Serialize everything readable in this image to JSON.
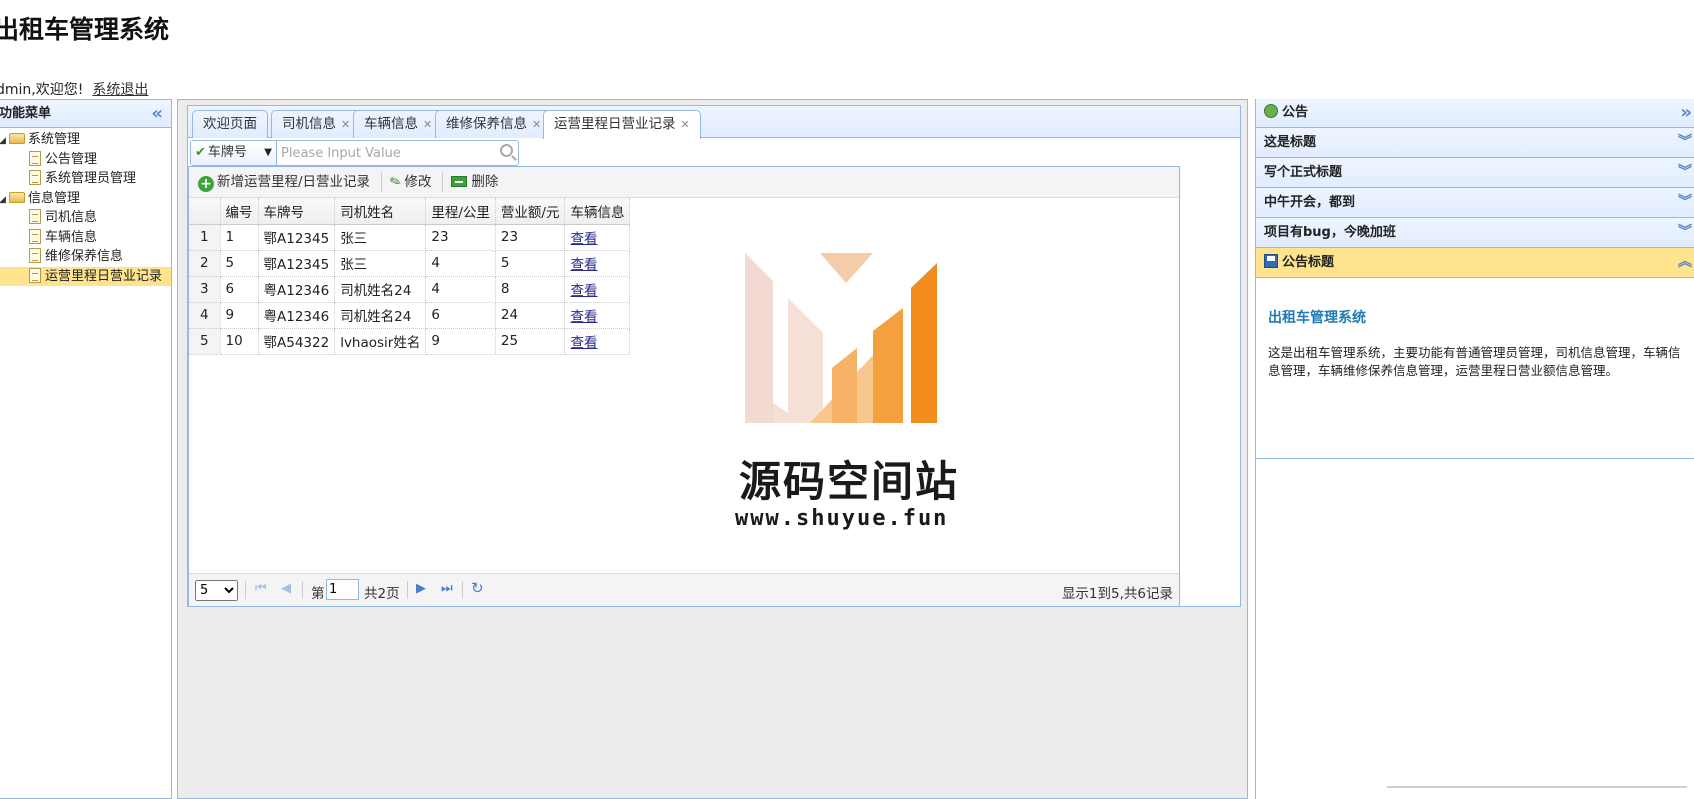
{
  "app": {
    "title": "出租车管理系统"
  },
  "user": {
    "welcome": "dmin,欢迎您!",
    "logout": "系统退出"
  },
  "menu": {
    "title": "功能菜单",
    "collapse_icon": "«",
    "groups": [
      {
        "label": "系统管理",
        "items": [
          "公告管理",
          "系统管理员管理"
        ]
      },
      {
        "label": "信息管理",
        "items": [
          "司机信息",
          "车辆信息",
          "维修保养信息",
          "运营里程日营业记录"
        ]
      }
    ]
  },
  "tabs": [
    {
      "label": "欢迎页面",
      "closable": false
    },
    {
      "label": "司机信息",
      "closable": true
    },
    {
      "label": "车辆信息",
      "closable": true
    },
    {
      "label": "维修保养信息",
      "closable": true
    },
    {
      "label": "运营里程日营业记录",
      "closable": true,
      "active": true
    }
  ],
  "search": {
    "field_label": "车牌号",
    "placeholder": "Please Input Value"
  },
  "toolbar": {
    "add_label": "新增运营里程/日营业记录",
    "edit_label": "修改",
    "delete_label": "删除"
  },
  "grid": {
    "columns": [
      "编号",
      "车牌号",
      "司机姓名",
      "里程/公里",
      "营业额/元",
      "车辆信息"
    ],
    "rows": [
      {
        "n": "1",
        "id": "1",
        "plate": "鄂A12345",
        "driver": "张三",
        "mileage": "23",
        "revenue": "23",
        "link": "查看"
      },
      {
        "n": "2",
        "id": "5",
        "plate": "鄂A12345",
        "driver": "张三",
        "mileage": "4",
        "revenue": "5",
        "link": "查看"
      },
      {
        "n": "3",
        "id": "6",
        "plate": "粤A12346",
        "driver": "司机姓名24",
        "mileage": "4",
        "revenue": "8",
        "link": "查看"
      },
      {
        "n": "4",
        "id": "9",
        "plate": "粤A12346",
        "driver": "司机姓名24",
        "mileage": "6",
        "revenue": "24",
        "link": "查看"
      },
      {
        "n": "5",
        "id": "10",
        "plate": "鄂A54322",
        "driver": "lvhaosir姓名",
        "mileage": "9",
        "revenue": "25",
        "link": "查看"
      }
    ]
  },
  "pager": {
    "page_size": "5",
    "page_prefix": "第",
    "page_value": "1",
    "page_total": "共2页",
    "info": "显示1到5,共6记录"
  },
  "watermark": {
    "name": "源码空间站",
    "url": "www.shuyue.fun"
  },
  "notice": {
    "title": "公告",
    "items": [
      "这是标题",
      "写个正式标题",
      "中午开会，都到",
      "项目有bug，今晚加班"
    ],
    "open_item": "公告标题",
    "body_title": "出租车管理系统",
    "body_text": "这是出租车管理系统，主要功能有普通管理员管理，司机信息管理，车辆信息管理，车辆维修保养信息管理，运营里程日营业额信息管理。"
  },
  "colors": {
    "border": "#95b8e7",
    "selected": "#ffe48d",
    "accent": "#1f7ab4"
  }
}
